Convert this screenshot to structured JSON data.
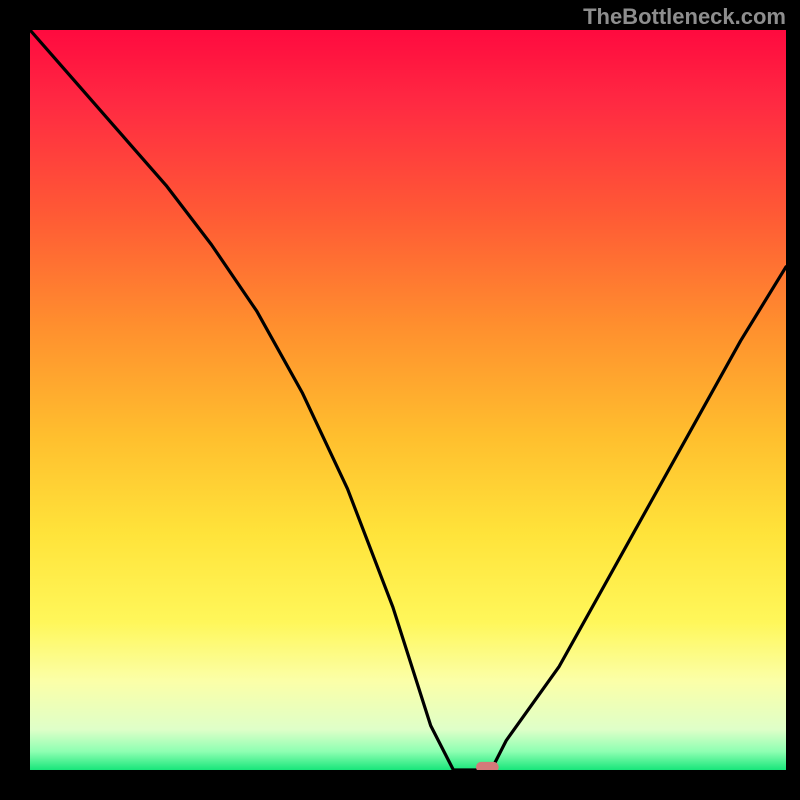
{
  "watermark": "TheBottleneck.com",
  "colors": {
    "gradient_stops": [
      {
        "offset": 0.0,
        "color": "#ff0a3f"
      },
      {
        "offset": 0.1,
        "color": "#ff2a42"
      },
      {
        "offset": 0.25,
        "color": "#ff5a35"
      },
      {
        "offset": 0.4,
        "color": "#ff8f2e"
      },
      {
        "offset": 0.55,
        "color": "#ffbf2e"
      },
      {
        "offset": 0.68,
        "color": "#ffe33a"
      },
      {
        "offset": 0.8,
        "color": "#fff75a"
      },
      {
        "offset": 0.88,
        "color": "#fbffa8"
      },
      {
        "offset": 0.945,
        "color": "#dfffc8"
      },
      {
        "offset": 0.975,
        "color": "#8effb2"
      },
      {
        "offset": 1.0,
        "color": "#18e67a"
      }
    ],
    "pill": "#d47a7a",
    "curve": "#000000",
    "background": "#000000"
  },
  "plot": {
    "inner_x": 30,
    "inner_y": 30,
    "inner_w": 756,
    "inner_h": 740
  },
  "chart_data": {
    "type": "line",
    "title": "",
    "xlabel": "",
    "ylabel": "",
    "xlim": [
      0,
      100
    ],
    "ylim": [
      0,
      100
    ],
    "x": [
      0,
      6,
      12,
      18,
      24,
      30,
      36,
      42,
      48,
      53,
      56,
      59,
      61,
      63,
      70,
      76,
      82,
      88,
      94,
      100
    ],
    "values": [
      100,
      93,
      86,
      79,
      71,
      62,
      51,
      38,
      22,
      6,
      0,
      0,
      0,
      4,
      14,
      25,
      36,
      47,
      58,
      68
    ],
    "marker": {
      "x": 60.5,
      "y": 0.4,
      "w": 3.0,
      "h": 1.4
    },
    "grid": false,
    "legend": false
  }
}
